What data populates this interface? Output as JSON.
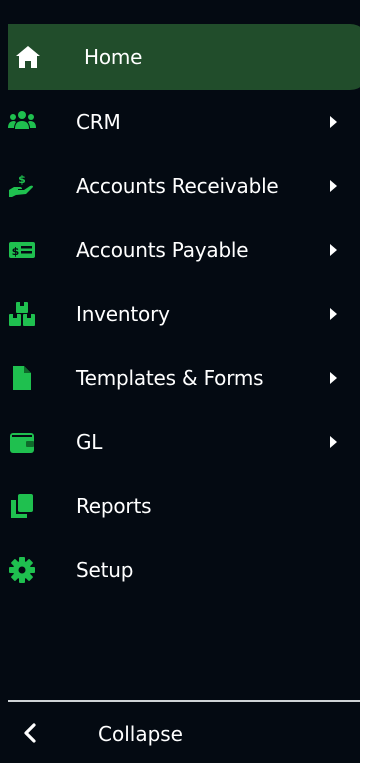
{
  "brand": {
    "accent": "#1fc04f",
    "active_bg": "#214d2b",
    "bg": "#040a12"
  },
  "menu": {
    "items": [
      {
        "label": "Home",
        "icon": "home-icon",
        "active": true,
        "submenu": false
      },
      {
        "label": "CRM",
        "icon": "users-icon",
        "submenu": true
      },
      {
        "label": "Accounts Receivable",
        "icon": "hand-dollar-icon",
        "submenu": true
      },
      {
        "label": "Accounts Payable",
        "icon": "money-bill-icon",
        "submenu": true
      },
      {
        "label": "Inventory",
        "icon": "boxes-icon",
        "submenu": true
      },
      {
        "label": "Templates & Forms",
        "icon": "file-icon",
        "submenu": true
      },
      {
        "label": "GL",
        "icon": "wallet-icon",
        "submenu": true
      },
      {
        "label": "Reports",
        "icon": "copy-icon",
        "submenu": false
      },
      {
        "label": "Setup",
        "icon": "gear-icon",
        "submenu": false
      }
    ]
  },
  "footer": {
    "collapse_label": "Collapse",
    "icon": "chevron-left-icon"
  }
}
